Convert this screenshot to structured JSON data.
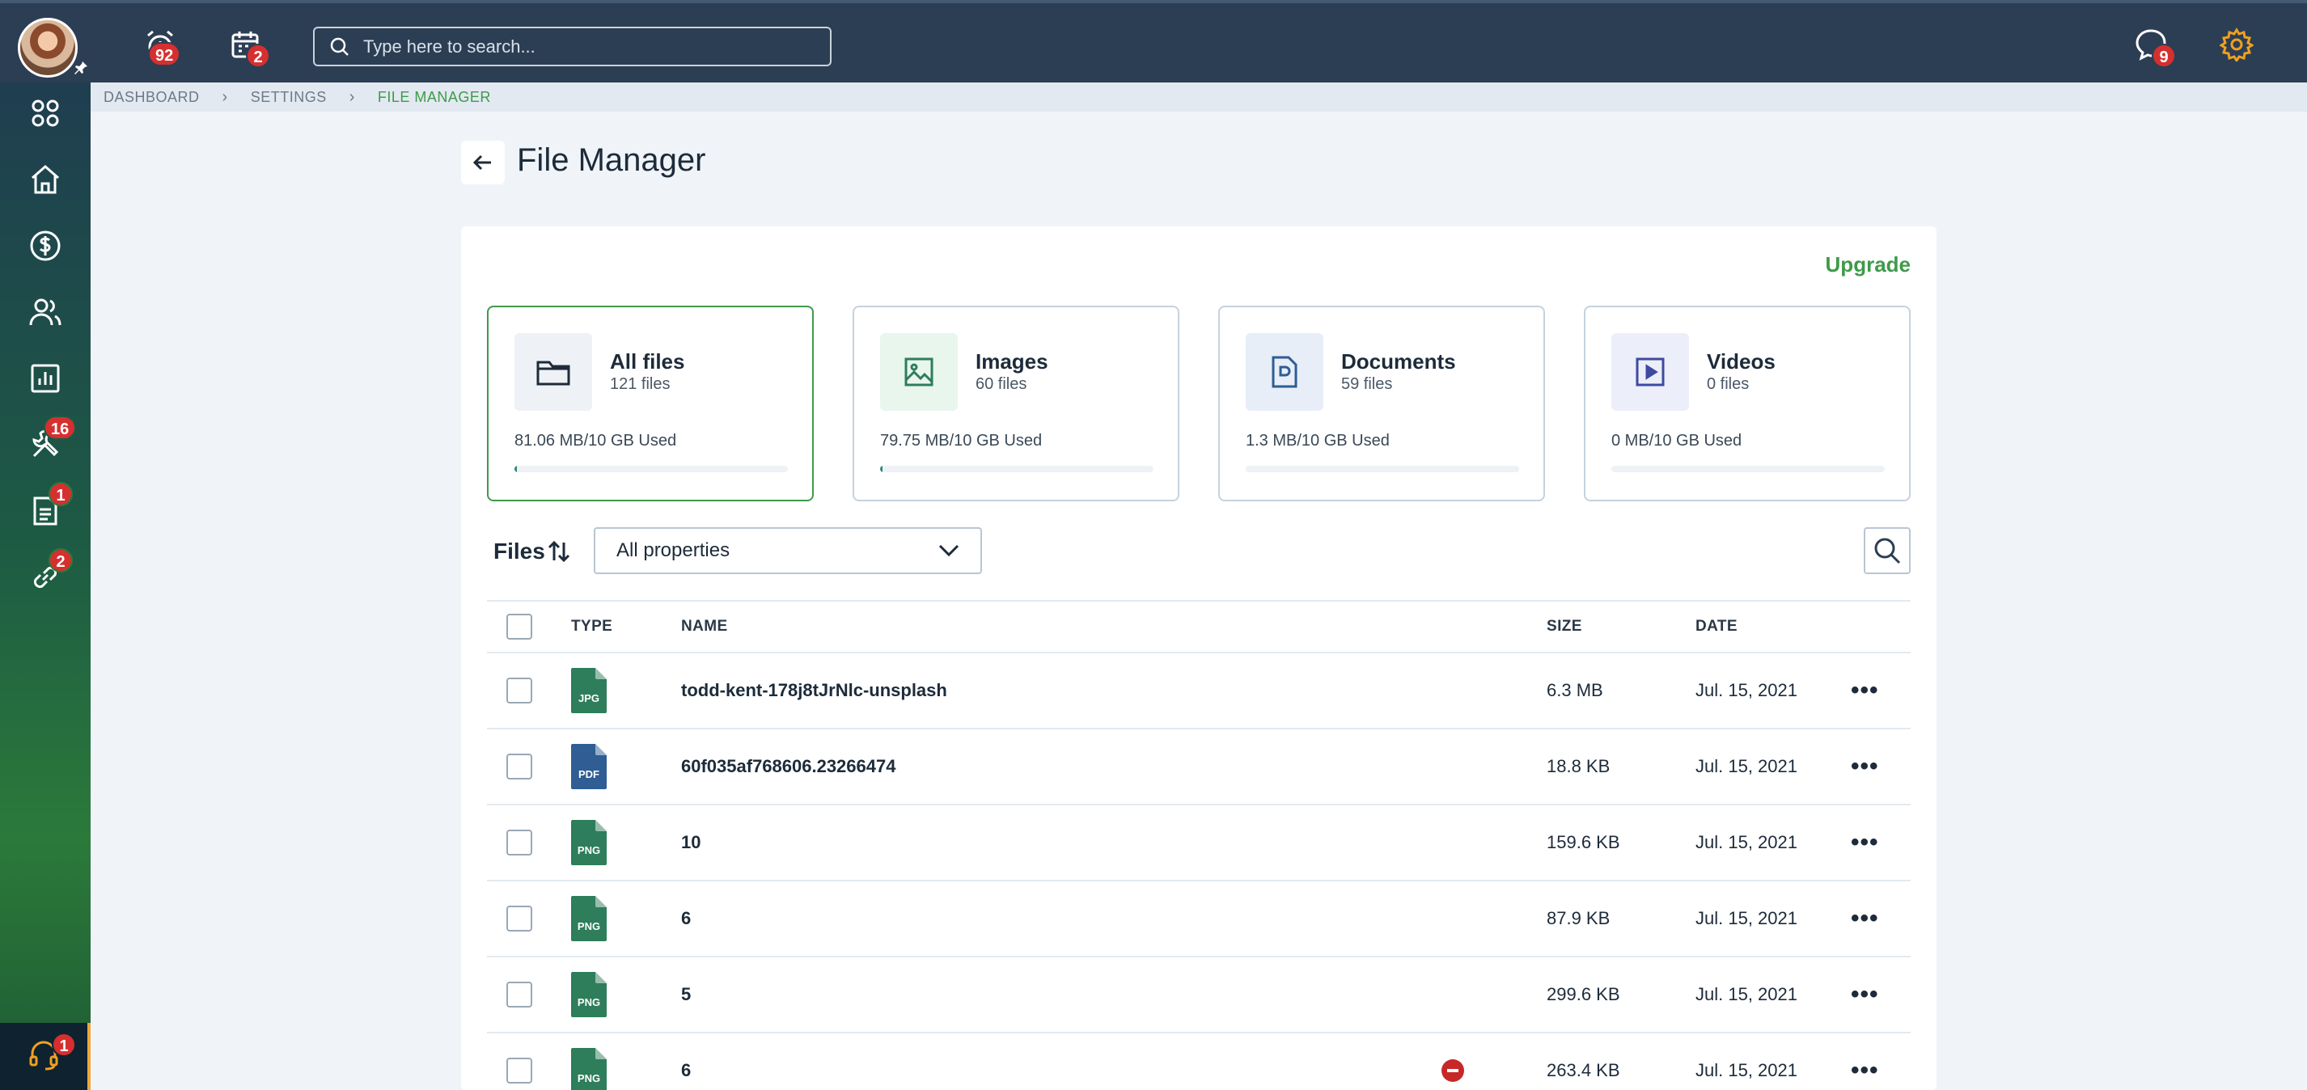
{
  "topbar": {
    "alerts_count": "92",
    "calendar_count": "2",
    "search_placeholder": "Type here to search...",
    "chat_count": "9"
  },
  "sidebar": {
    "tools_count": "16",
    "docs_count": "1",
    "links_count": "2",
    "support_count": "1"
  },
  "breadcrumb": [
    "DASHBOARD",
    "SETTINGS",
    "FILE MANAGER"
  ],
  "page": {
    "title": "File Manager"
  },
  "upgrade_label": "Upgrade",
  "cards": [
    {
      "title": "All files",
      "count": "121 files",
      "used": "81.06 MB/10 GB Used",
      "fill": 0.008,
      "icon": "folder-icon"
    },
    {
      "title": "Images",
      "count": "60 files",
      "used": "79.75 MB/10 GB Used",
      "fill": 0.008,
      "icon": "image-icon"
    },
    {
      "title": "Documents",
      "count": "59 files",
      "used": "1.3 MB/10 GB Used",
      "fill": 0.0,
      "icon": "document-icon"
    },
    {
      "title": "Videos",
      "count": "0 files",
      "used": "0 MB/10 GB Used",
      "fill": 0.0,
      "icon": "video-icon"
    }
  ],
  "files_label": "Files",
  "filter": {
    "selected": "All properties"
  },
  "table": {
    "headers": {
      "type": "TYPE",
      "name": "NAME",
      "size": "SIZE",
      "date": "DATE"
    },
    "rows": [
      {
        "type": "JPG",
        "name": "todd-kent-178j8tJrNlc-unsplash",
        "size": "6.3 MB",
        "date": "Jul. 15, 2021",
        "color": "#2e7d5b"
      },
      {
        "type": "PDF",
        "name": "60f035af768606.23266474",
        "size": "18.8 KB",
        "date": "Jul. 15, 2021",
        "color": "#2f5d94"
      },
      {
        "type": "PNG",
        "name": "10",
        "size": "159.6 KB",
        "date": "Jul. 15, 2021",
        "color": "#2e7d5b"
      },
      {
        "type": "PNG",
        "name": "6",
        "size": "87.9 KB",
        "date": "Jul. 15, 2021",
        "color": "#2e7d5b"
      },
      {
        "type": "PNG",
        "name": "5",
        "size": "299.6 KB",
        "date": "Jul. 15, 2021",
        "color": "#2e7d5b"
      },
      {
        "type": "PNG",
        "name": "6",
        "size": "263.4 KB",
        "date": "Jul. 15, 2021",
        "color": "#2e7d5b"
      }
    ]
  }
}
